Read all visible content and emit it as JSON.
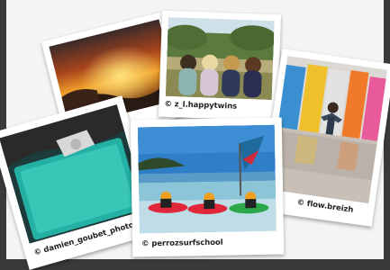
{
  "photos": [
    {
      "name": "sunset-photo",
      "caption": ""
    },
    {
      "name": "twins-photo",
      "caption": "© z_l.happytwins"
    },
    {
      "name": "beach-cabins-photo",
      "caption": "© flow.breizh"
    },
    {
      "name": "pool-aerial-photo",
      "caption": "© damien_goubet_photographe"
    },
    {
      "name": "surf-school-photo",
      "caption": "© perrozsurfschool"
    }
  ],
  "colors": {
    "frame_background": "#3a3a3a",
    "board_background": "#f4f4f2",
    "polaroid_border": "#ffffff"
  }
}
